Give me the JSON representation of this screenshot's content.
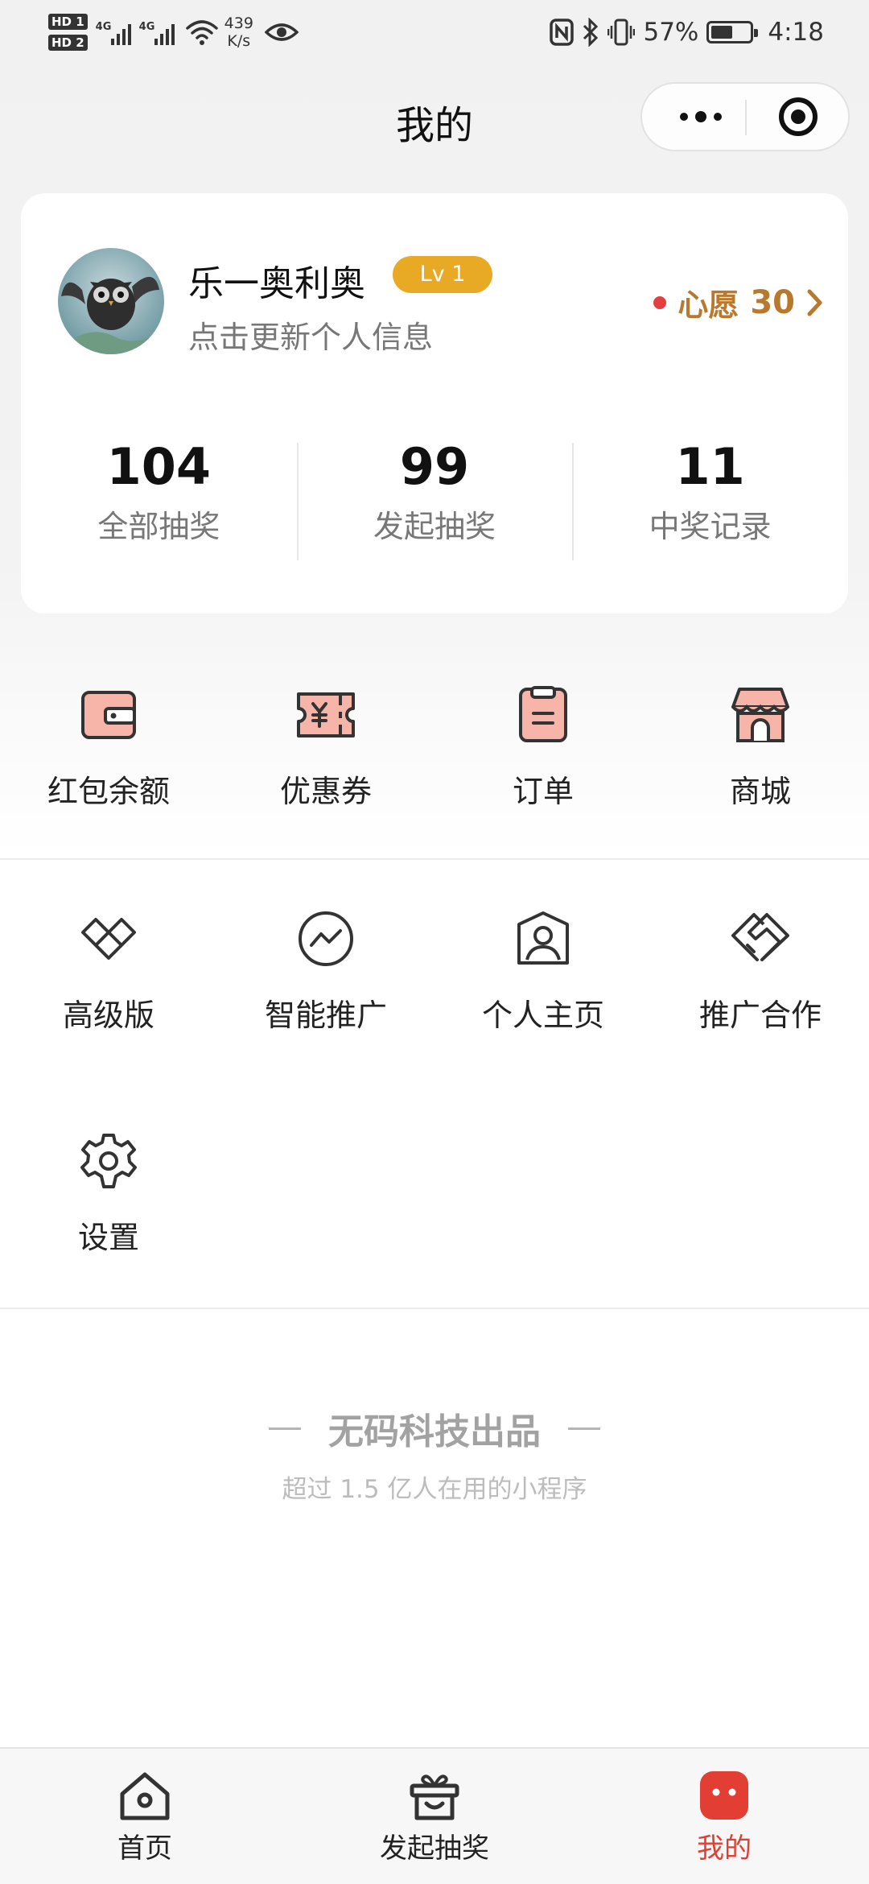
{
  "status_bar": {
    "hd1": "HD 1",
    "hd2": "HD 2",
    "sim1": "4G",
    "sim2": "4G",
    "speed_value": "439",
    "speed_unit": "K/s",
    "battery_percent": "57%",
    "battery_level": 0.57,
    "time": "4:18"
  },
  "header": {
    "title": "我的",
    "more_icon": "more-dots-icon",
    "close_icon": "target-close-icon"
  },
  "profile": {
    "username": "乐一奥利奥",
    "level_badge": "Lv 1",
    "subtitle": "点击更新个人信息",
    "wish_label": "心愿",
    "wish_count": "30",
    "wish_dot_color": "#e53e3e",
    "wish_color": "#b9792d",
    "stats": [
      {
        "value": "104",
        "label": "全部抽奖"
      },
      {
        "value": "99",
        "label": "发起抽奖"
      },
      {
        "value": "11",
        "label": "中奖记录"
      }
    ]
  },
  "grid_primary": [
    {
      "label": "红包余额",
      "icon": "wallet-icon"
    },
    {
      "label": "优惠券",
      "icon": "coupon-icon"
    },
    {
      "label": "订单",
      "icon": "order-clipboard-icon"
    },
    {
      "label": "商城",
      "icon": "store-icon"
    }
  ],
  "grid_secondary": [
    {
      "label": "高级版",
      "icon": "diamond-icon"
    },
    {
      "label": "智能推广",
      "icon": "trend-chart-icon"
    },
    {
      "label": "个人主页",
      "icon": "user-profile-icon"
    },
    {
      "label": "推广合作",
      "icon": "handshake-icon"
    },
    {
      "label": "设置",
      "icon": "gear-icon"
    }
  ],
  "brand": {
    "name": "无码科技出品",
    "slogan": "超过 1.5 亿人在用的小程序"
  },
  "tabbar": [
    {
      "label": "首页",
      "icon": "home-icon",
      "active": false
    },
    {
      "label": "发起抽奖",
      "icon": "gift-box-icon",
      "active": false
    },
    {
      "label": "我的",
      "icon": "mine-face-icon",
      "active": true
    }
  ],
  "colors": {
    "accent_red": "#e33e33",
    "icon_fill": "#f7b5a9",
    "icon_stroke": "#333333",
    "level_badge": "#e8a924"
  }
}
